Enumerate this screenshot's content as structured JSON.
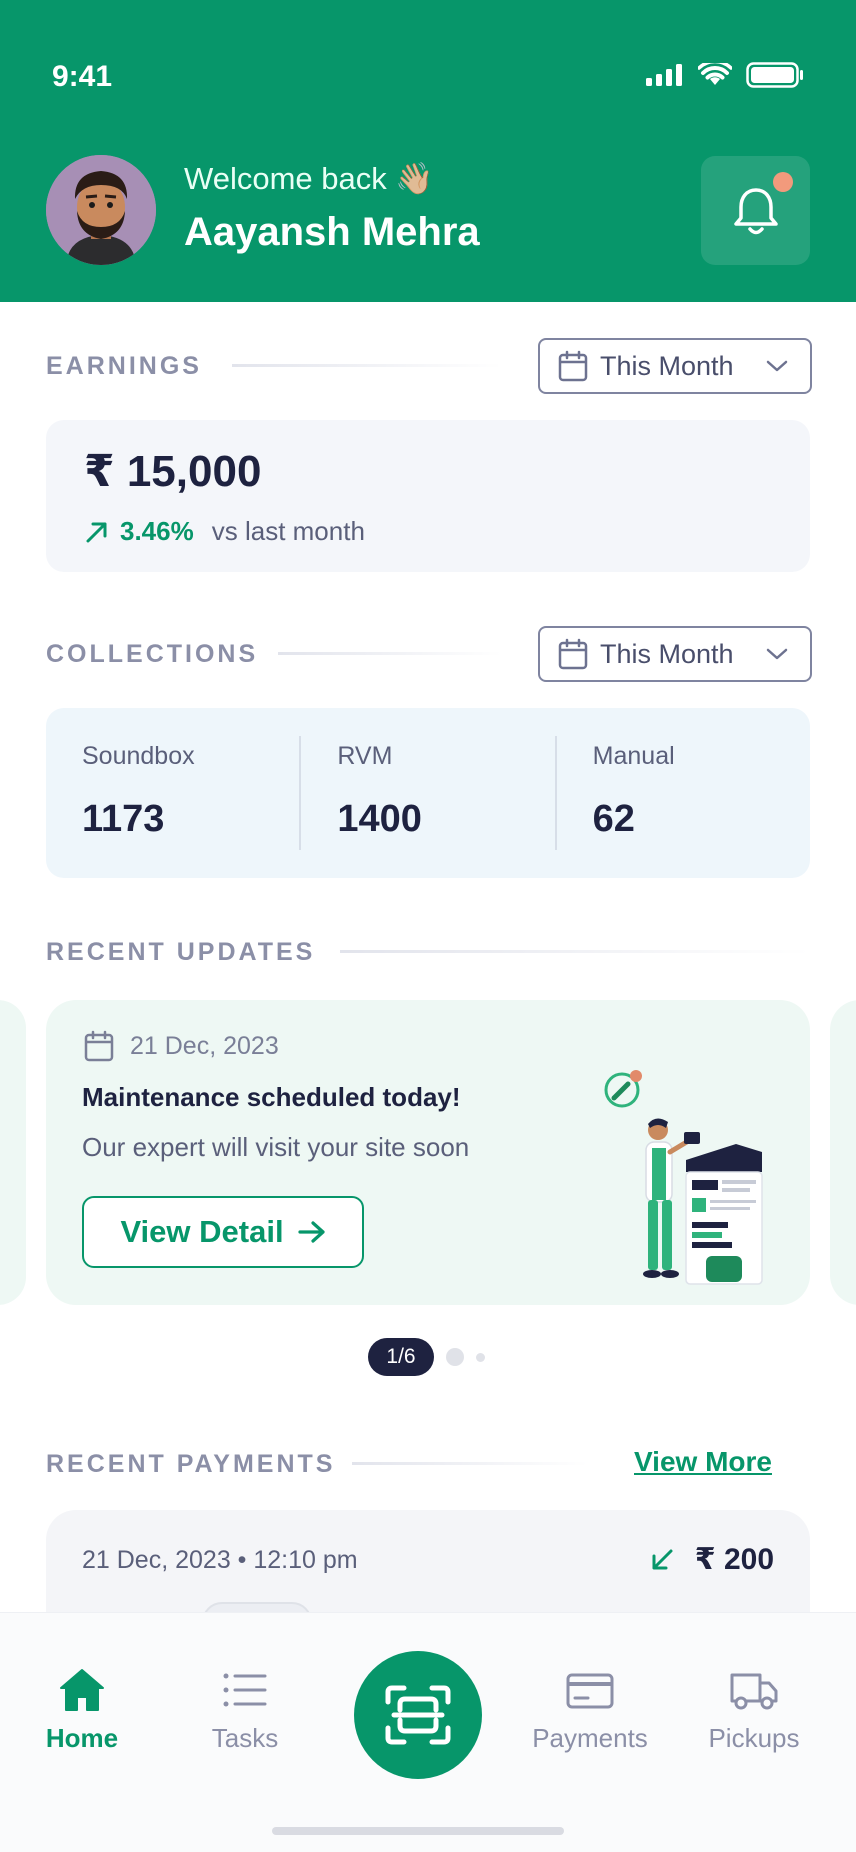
{
  "status_bar": {
    "time": "9:41"
  },
  "header": {
    "welcome": "Welcome back 👋🏼",
    "user_name": "Aayansh Mehra"
  },
  "earnings": {
    "title": "EARNINGS",
    "filter": "This Month",
    "amount": "₹ 15,000",
    "change_pct": "3.46%",
    "change_text": "vs last month"
  },
  "collections": {
    "title": "COLLECTIONS",
    "filter": "This Month",
    "items": [
      {
        "label": "Soundbox",
        "value": "1173"
      },
      {
        "label": "RVM",
        "value": "1400"
      },
      {
        "label": "Manual",
        "value": "62"
      }
    ]
  },
  "updates": {
    "title": "RECENT UPDATES",
    "date": "21 Dec, 2023",
    "headline": "Maintenance scheduled today!",
    "description": "Our expert will visit your site soon",
    "button": "View Detail",
    "pager": "1/6"
  },
  "payments": {
    "title": "RECENT PAYMENTS",
    "view_more": "View More",
    "items": [
      {
        "datetime": "21 Dec, 2023 • 12:10 pm",
        "amount": "₹ 200"
      }
    ]
  },
  "nav": {
    "items": [
      {
        "label": "Home",
        "icon": "home-icon",
        "active": true
      },
      {
        "label": "Tasks",
        "icon": "list-icon"
      },
      {
        "label": "Payments",
        "icon": "card-icon"
      },
      {
        "label": "Pickups",
        "icon": "truck-icon"
      }
    ]
  },
  "colors": {
    "brand": "#07966a",
    "dark": "#1e2240",
    "muted": "#8b8fa7",
    "notification_dot": "#f29a7c"
  }
}
